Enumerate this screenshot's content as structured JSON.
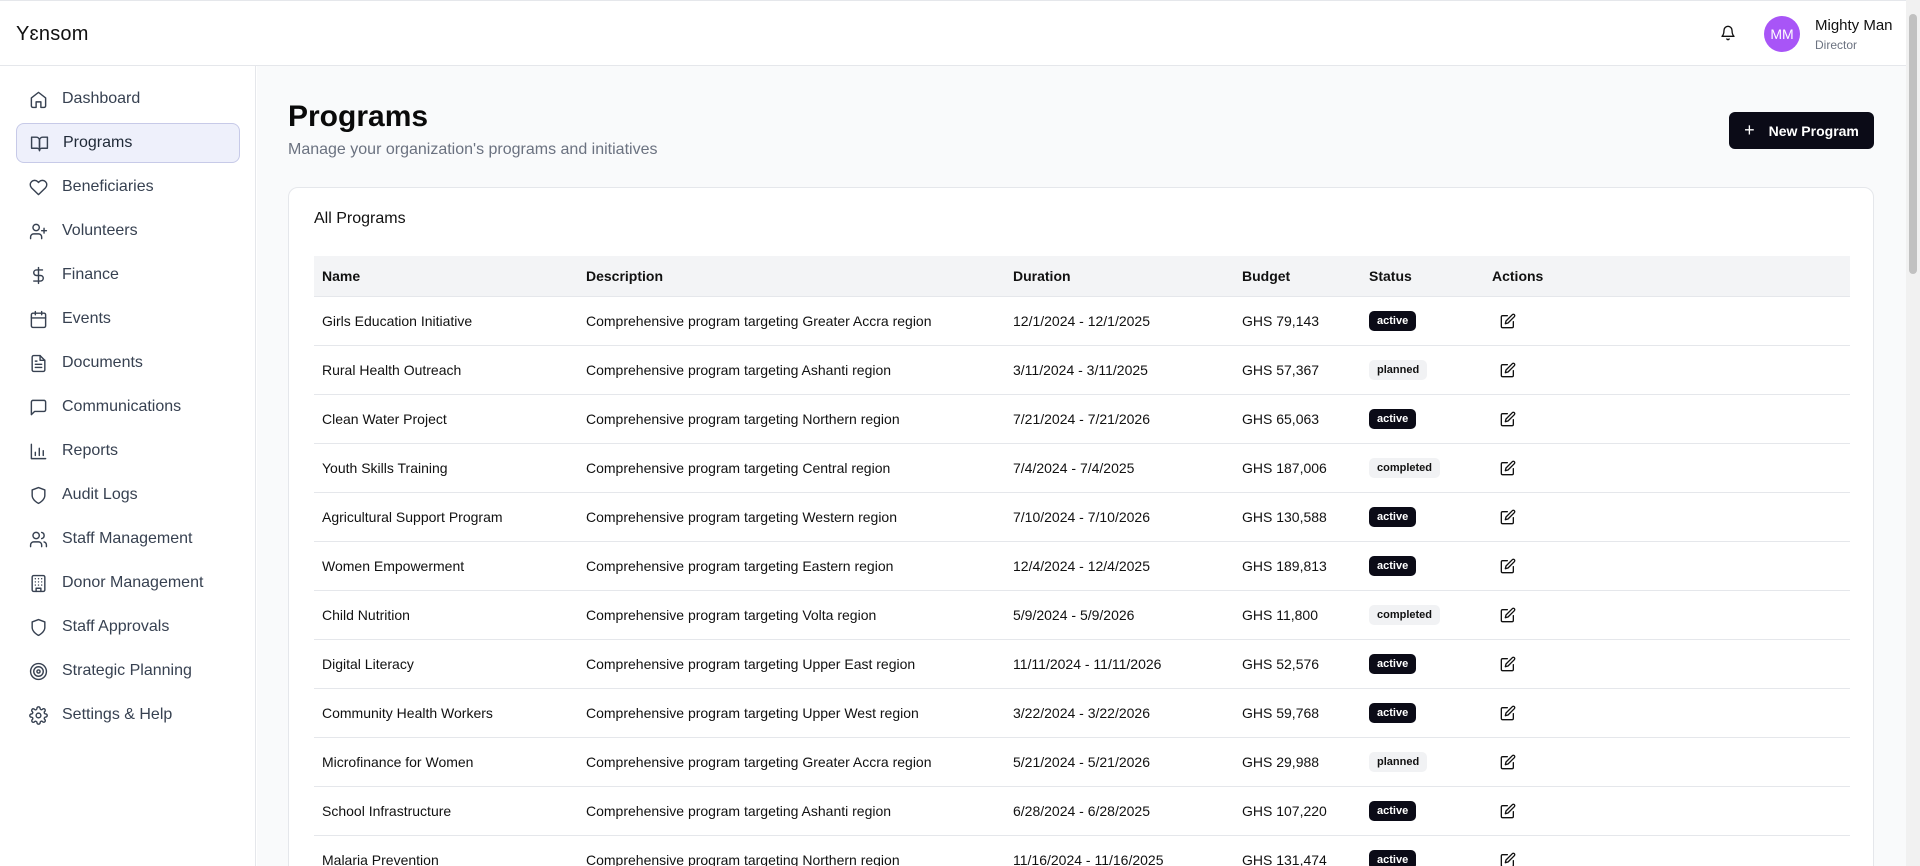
{
  "app": {
    "brand": "Yɛnsom"
  },
  "header": {
    "user_initials": "MM",
    "user_name": "Mighty Man",
    "user_role": "Director"
  },
  "sidebar": {
    "items": [
      {
        "label": "Dashboard",
        "icon": "home-icon"
      },
      {
        "label": "Programs",
        "icon": "book-open-icon",
        "active": true
      },
      {
        "label": "Beneficiaries",
        "icon": "heart-icon"
      },
      {
        "label": "Volunteers",
        "icon": "user-plus-icon"
      },
      {
        "label": "Finance",
        "icon": "dollar-icon"
      },
      {
        "label": "Events",
        "icon": "calendar-icon"
      },
      {
        "label": "Documents",
        "icon": "file-text-icon"
      },
      {
        "label": "Communications",
        "icon": "message-square-icon"
      },
      {
        "label": "Reports",
        "icon": "bar-chart-icon"
      },
      {
        "label": "Audit Logs",
        "icon": "shield-icon"
      },
      {
        "label": "Staff Management",
        "icon": "users-icon"
      },
      {
        "label": "Donor Management",
        "icon": "building-icon"
      },
      {
        "label": "Staff Approvals",
        "icon": "shield-icon"
      },
      {
        "label": "Strategic Planning",
        "icon": "target-icon"
      },
      {
        "label": "Settings & Help",
        "icon": "gear-icon"
      }
    ]
  },
  "page": {
    "title": "Programs",
    "subtitle": "Manage your organization's programs and initiatives",
    "new_button": "New Program",
    "card_title": "All Programs"
  },
  "table": {
    "columns": [
      "Name",
      "Description",
      "Duration",
      "Budget",
      "Status",
      "Actions"
    ],
    "rows": [
      {
        "name": "Girls Education Initiative",
        "description": "Comprehensive program targeting Greater Accra region",
        "duration": "12/1/2024 - 12/1/2025",
        "budget": "GHS 79,143",
        "status": "active"
      },
      {
        "name": "Rural Health Outreach",
        "description": "Comprehensive program targeting Ashanti region",
        "duration": "3/11/2024 - 3/11/2025",
        "budget": "GHS 57,367",
        "status": "planned"
      },
      {
        "name": "Clean Water Project",
        "description": "Comprehensive program targeting Northern region",
        "duration": "7/21/2024 - 7/21/2026",
        "budget": "GHS 65,063",
        "status": "active"
      },
      {
        "name": "Youth Skills Training",
        "description": "Comprehensive program targeting Central region",
        "duration": "7/4/2024 - 7/4/2025",
        "budget": "GHS 187,006",
        "status": "completed"
      },
      {
        "name": "Agricultural Support Program",
        "description": "Comprehensive program targeting Western region",
        "duration": "7/10/2024 - 7/10/2026",
        "budget": "GHS 130,588",
        "status": "active"
      },
      {
        "name": "Women Empowerment",
        "description": "Comprehensive program targeting Eastern region",
        "duration": "12/4/2024 - 12/4/2025",
        "budget": "GHS 189,813",
        "status": "active"
      },
      {
        "name": "Child Nutrition",
        "description": "Comprehensive program targeting Volta region",
        "duration": "5/9/2024 - 5/9/2026",
        "budget": "GHS 11,800",
        "status": "completed"
      },
      {
        "name": "Digital Literacy",
        "description": "Comprehensive program targeting Upper East region",
        "duration": "11/11/2024 - 11/11/2026",
        "budget": "GHS 52,576",
        "status": "active"
      },
      {
        "name": "Community Health Workers",
        "description": "Comprehensive program targeting Upper West region",
        "duration": "3/22/2024 - 3/22/2026",
        "budget": "GHS 59,768",
        "status": "active"
      },
      {
        "name": "Microfinance for Women",
        "description": "Comprehensive program targeting Greater Accra region",
        "duration": "5/21/2024 - 5/21/2026",
        "budget": "GHS 29,988",
        "status": "planned"
      },
      {
        "name": "School Infrastructure",
        "description": "Comprehensive program targeting Ashanti region",
        "duration": "6/28/2024 - 6/28/2025",
        "budget": "GHS 107,220",
        "status": "active"
      },
      {
        "name": "Malaria Prevention",
        "description": "Comprehensive program targeting Northern region",
        "duration": "11/16/2024 - 11/16/2025",
        "budget": "GHS 131,474",
        "status": "active"
      }
    ]
  },
  "colors": {
    "primary": "#0b0b17",
    "avatar": "#a855f7",
    "active_nav_bg": "#eef0fb"
  }
}
